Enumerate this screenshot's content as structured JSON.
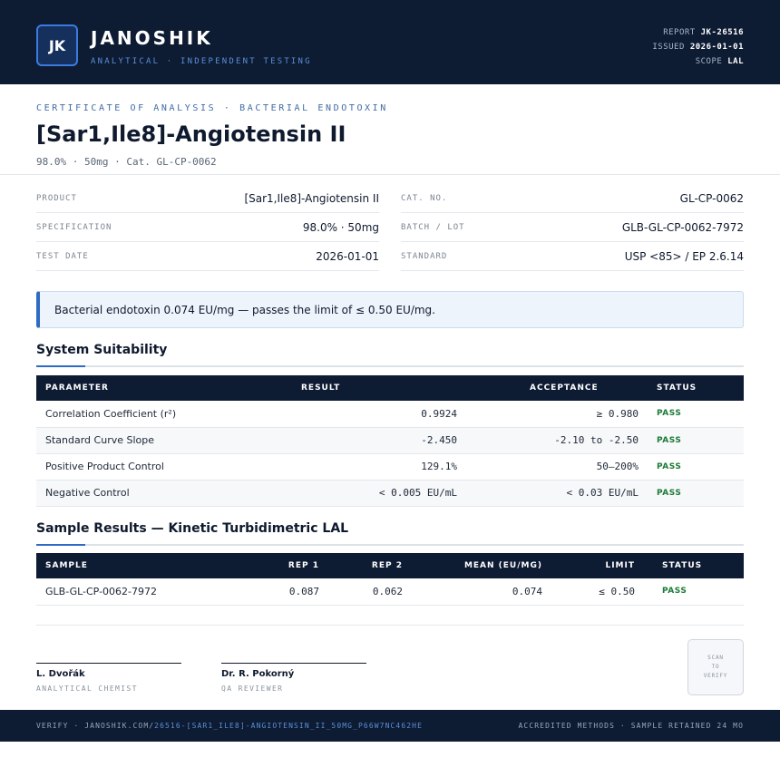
{
  "header": {
    "logo": "JK",
    "brand": "JANOSHIK",
    "tagline": "ANALYTICAL · INDEPENDENT TESTING",
    "report_label": "REPORT",
    "report_value": "JK-26516",
    "issued_label": "ISSUED",
    "issued_value": "2026-01-01",
    "scope_label": "SCOPE",
    "scope_value": "LAL"
  },
  "title_block": {
    "eyebrow": "CERTIFICATE OF ANALYSIS · BACTERIAL ENDOTOXIN",
    "title": "[Sar1,Ile8]-Angiotensin II",
    "subline": "98.0% · 50mg  ·  Cat. GL-CP-0062"
  },
  "info": {
    "left": [
      {
        "label": "PRODUCT",
        "value": "[Sar1,Ile8]-Angiotensin II"
      },
      {
        "label": "SPECIFICATION",
        "value": "98.0% · 50mg"
      },
      {
        "label": "TEST DATE",
        "value": "2026-01-01"
      }
    ],
    "right": [
      {
        "label": "CAT. NO.",
        "value": "GL-CP-0062"
      },
      {
        "label": "BATCH / LOT",
        "value": "GLB-GL-CP-0062-7972"
      },
      {
        "label": "STANDARD",
        "value": "USP <85> / EP 2.6.14"
      }
    ]
  },
  "callout": "Bacterial endotoxin 0.074 EU/mg — passes the limit of ≤ 0.50 EU/mg.",
  "system_suitability": {
    "title": "System Suitability",
    "headers": [
      "PARAMETER",
      "RESULT",
      "ACCEPTANCE",
      "STATUS"
    ],
    "rows": [
      [
        "Correlation Coefficient (r²)",
        "0.9924",
        "≥ 0.980",
        "PASS"
      ],
      [
        "Standard Curve Slope",
        "-2.450",
        "-2.10 to -2.50",
        "PASS"
      ],
      [
        "Positive Product Control",
        "129.1%",
        "50–200%",
        "PASS"
      ],
      [
        "Negative Control",
        "< 0.005 EU/mL",
        "< 0.03 EU/mL",
        "PASS"
      ]
    ]
  },
  "sample_results": {
    "title": "Sample Results — Kinetic Turbidimetric LAL",
    "headers": [
      "SAMPLE",
      "REP 1",
      "REP 2",
      "MEAN (EU/MG)",
      "LIMIT",
      "STATUS"
    ],
    "rows": [
      [
        "GLB-GL-CP-0062-7972",
        "0.087",
        "0.062",
        "0.074",
        "≤ 0.50",
        "PASS"
      ]
    ]
  },
  "signatures": [
    {
      "name": "L. Dvořák",
      "role": "ANALYTICAL CHEMIST"
    },
    {
      "name": "Dr. R. Pokorný",
      "role": "QA REVIEWER"
    }
  ],
  "qr": {
    "line1": "SCAN",
    "line2": "TO",
    "line3": "VERIFY"
  },
  "footer": {
    "verify_prefix": "VERIFY · JANOSHIK.COM/",
    "verify_link": "26516-[SAR1_ILE8]-ANGIOTENSIN_II_50MG_P66W7NC462HE",
    "right": "ACCREDITED METHODS · SAMPLE RETAINED 24 MO"
  },
  "colors": {
    "navy": "#0d1b33",
    "accent": "#2f6bc2",
    "pass": "#1d7a37"
  }
}
